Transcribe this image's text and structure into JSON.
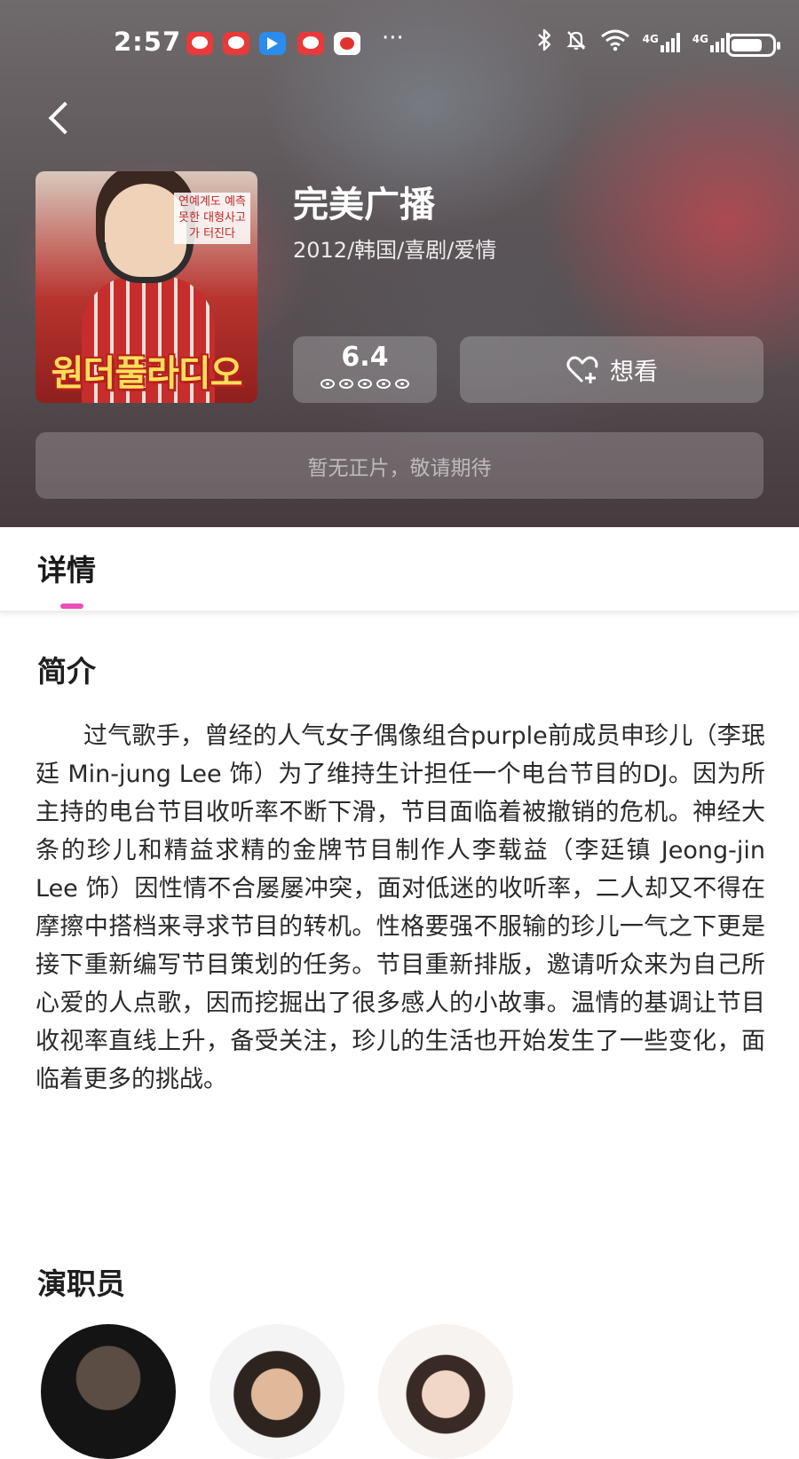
{
  "status_bar": {
    "time": "2:57",
    "more": "···",
    "network_1": "4G",
    "network_2": "4G",
    "icons": [
      "bluetooth-icon",
      "mute-icon",
      "wifi-icon",
      "signal-icon",
      "signal-icon",
      "battery-icon"
    ]
  },
  "movie": {
    "title": "完美广播",
    "meta": "2012/韩国/喜剧/爱情",
    "score": "6.4",
    "want_label": "想看",
    "notice": "暂无正片，敬请期待",
    "poster": {
      "title_text": "원더풀라디오",
      "tag_text": "연예계도 예측 못한 대형사고가 터진다"
    }
  },
  "tabs": {
    "detail": "详情"
  },
  "sections": {
    "intro_title": "简介",
    "intro_text": "过气歌手，曾经的人气女子偶像组合purple前成员申珍儿（李珉廷 Min-jung Lee 饰）为了维持生计担任一个电台节目的DJ。因为所主持的电台节目收听率不断下滑，节目面临着被撤销的危机。神经大条的珍儿和精益求精的金牌节目制作人李载益（李廷镇 Jeong-jin Lee 饰）因性情不合屡屡冲突，面对低迷的收听率，二人却又不得在摩擦中搭档来寻求节目的转机。性格要强不服输的珍儿一气之下更是接下重新编写节目策划的任务。节目重新排版，邀请听众来为自己所心爱的人点歌，因而挖掘出了很多感人的小故事。温情的基调让节目收视率直线上升，备受关注，珍儿的生活也开始发生了一些变化，面临着更多的挑战。",
    "cast_title": "演职员"
  },
  "colors": {
    "accent": "#e94fba",
    "text_primary": "#1a1a1a"
  }
}
